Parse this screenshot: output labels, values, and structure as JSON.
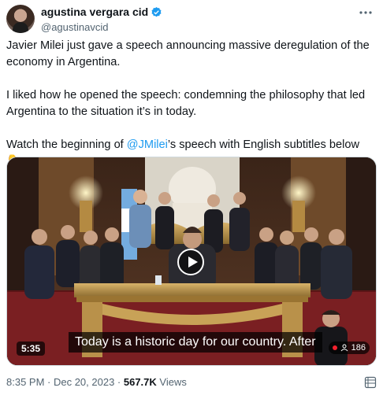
{
  "author": {
    "display_name": "agustina vergara cid",
    "handle": "@agustinavcid"
  },
  "tweet": {
    "line1": "Javier Milei just gave a speech announcing massive deregulation of the economy in Argentina.",
    "line2": "I liked how he opened the speech: condemning the philosophy that led Argentina to the situation it’s in today.",
    "line3_before": "Watch the beginning of ",
    "line3_mention": "@JMilei",
    "line3_after": "’s speech with English subtitles below 👇"
  },
  "video": {
    "duration": "5:35",
    "subtitle": "Today is a historic day for our country. After",
    "viewer_count": "186"
  },
  "meta": {
    "timestamp": "8:35 PM · Dec 20, 2023 · ",
    "views_num": "567.7K",
    "views_label": " Views"
  },
  "colors": {
    "accent": "#1d9bf0",
    "secondary_text": "#536471",
    "live_red": "#f4212e"
  },
  "icons": [
    "verified-badge-icon",
    "more-options-icon",
    "play-icon",
    "people-icon",
    "grid-icon"
  ]
}
